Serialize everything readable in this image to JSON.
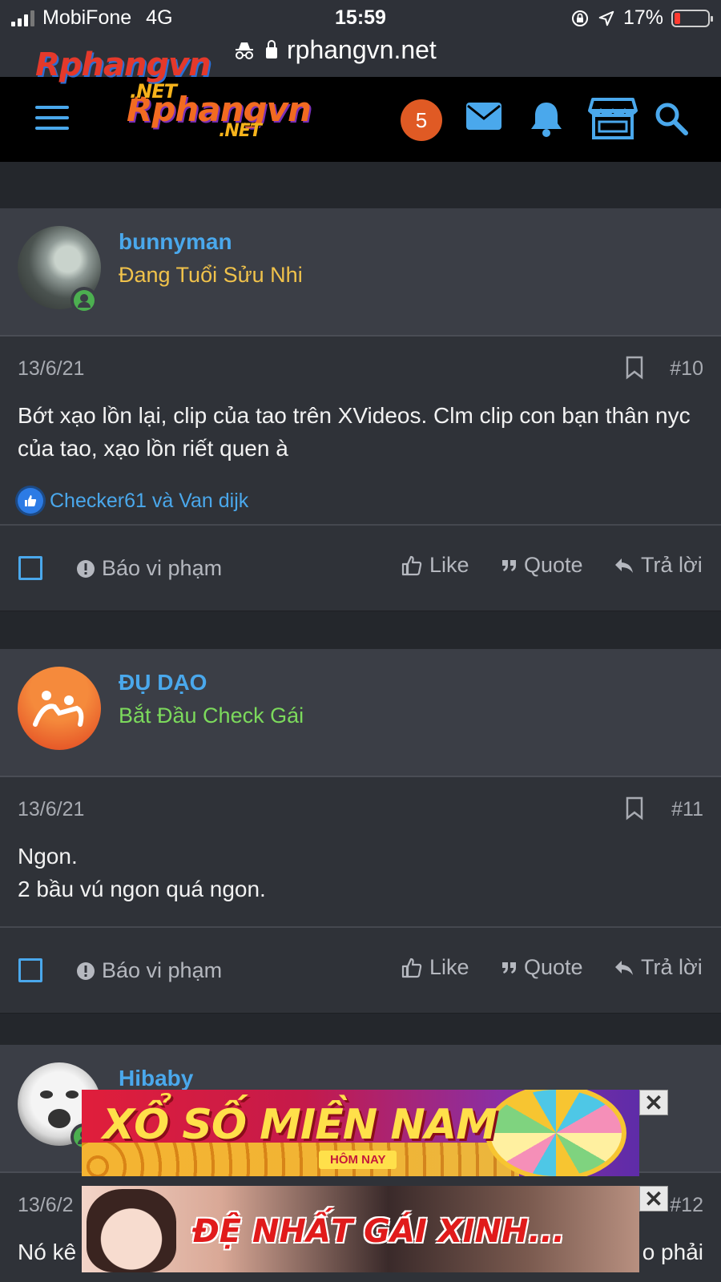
{
  "status": {
    "carrier": "MobiFone",
    "network": "4G",
    "time": "15:59",
    "battery": "17%",
    "battery_level": 0.17
  },
  "browser": {
    "url": "rphangvn.net"
  },
  "header": {
    "logo_text": "Rphangvn",
    "logo_suffix": ".NET",
    "notification_count": "5"
  },
  "posts": [
    {
      "username": "bunnyman",
      "user_title": "Đang Tuổi Sửu Nhi",
      "user_title_color": "#f0c24b",
      "date": "13/6/21",
      "number": "#10",
      "body": [
        "Bớt xạo lồn lại, clip của tao trên XVideos. Clm clip con bạn thân nyc của tao, xạo lồn riết quen à"
      ],
      "reactions": "Checker61 và Van dijk"
    },
    {
      "username": "ĐỤ DẠO",
      "user_title": "Bắt Đầu Check Gái",
      "user_title_color": "#7cda5c",
      "date": "13/6/21",
      "number": "#11",
      "body": [
        "Ngon.",
        "2 bầu vú ngon quá ngon."
      ]
    },
    {
      "username": "Hibaby",
      "date": "13/6/2",
      "number": "#12",
      "body_left": "Nó kê",
      "body_right": "o phải"
    }
  ],
  "actions": {
    "report": "Báo vi phạm",
    "like": "Like",
    "quote": "Quote",
    "reply": "Trả lời"
  },
  "ads": {
    "lottery_text": "XỔ SỐ MIỀN NAM",
    "lottery_sub": "HÔM NAY",
    "girls_text": "ĐỆ NHẤT GÁI XINH..."
  },
  "colors": {
    "accent": "#4aa8ec",
    "background": "#24272c",
    "badge": "#e05a24"
  }
}
